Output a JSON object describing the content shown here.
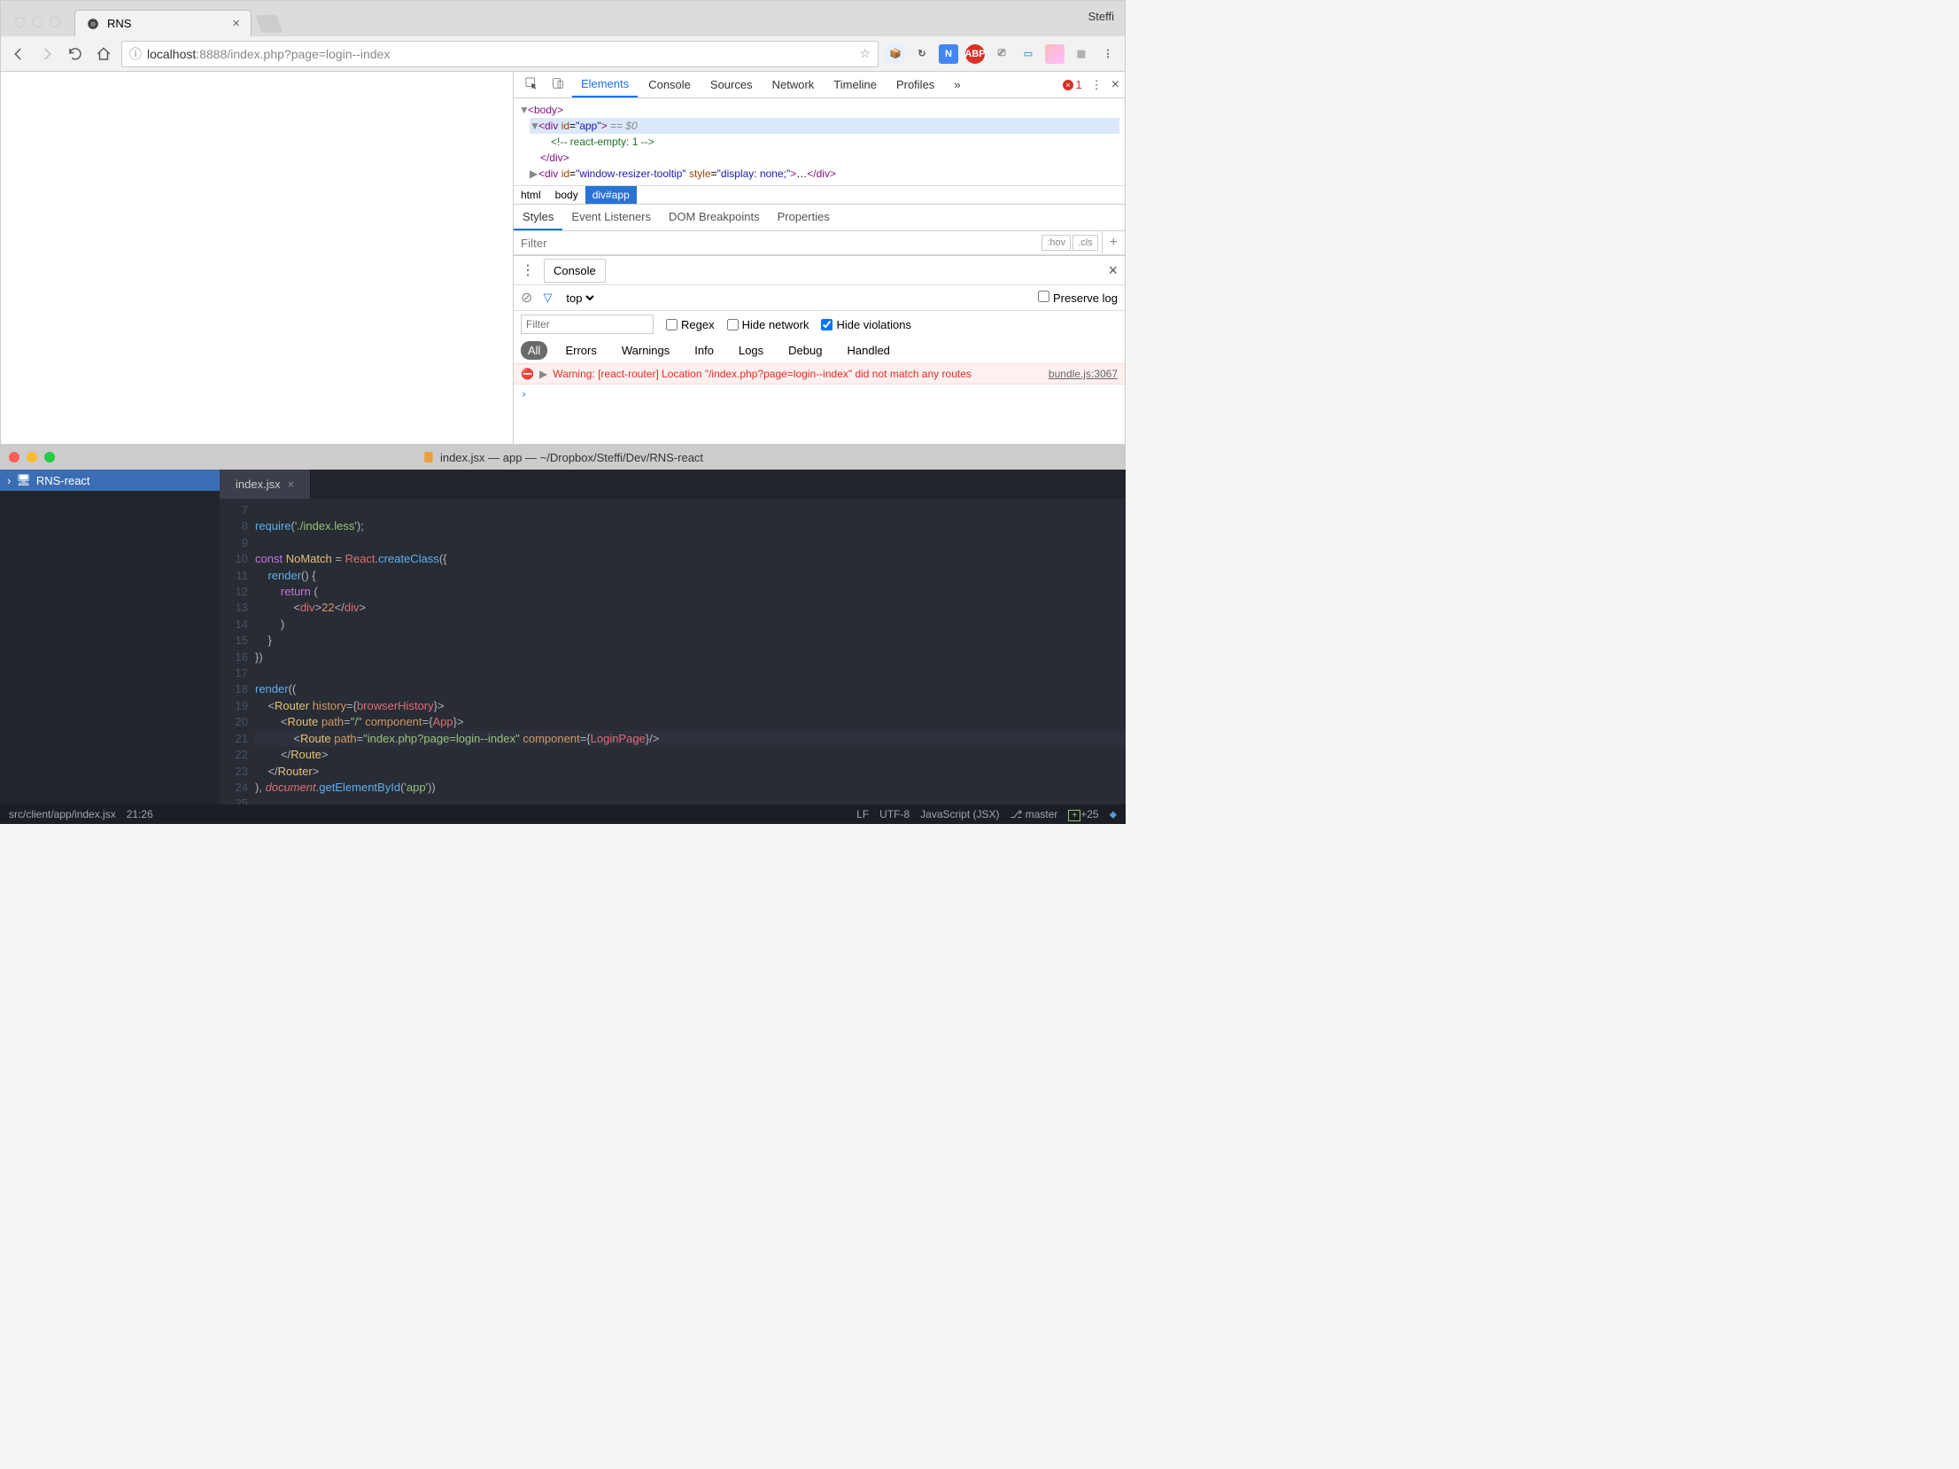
{
  "chrome": {
    "profile": "Steffi",
    "tab_title": "RNS",
    "url_host": "localhost",
    "url_port": ":8888",
    "url_path": "/index.php?page=login--index",
    "devtools": {
      "tabs": [
        "Elements",
        "Console",
        "Sources",
        "Network",
        "Timeline",
        "Profiles"
      ],
      "error_count": "1",
      "dom": {
        "body_open": "<body>",
        "div_app_open": "<div id=\"app\">",
        "eq0": " == $0",
        "react_comment": "<!-- react-empty: 1 -->",
        "div_close": "</div>",
        "window_resizer": "<div id=\"window-resizer-tooltip\" style=\"display: none;\">…</div>"
      },
      "breadcrumb": [
        "html",
        "body",
        "div#app"
      ],
      "styles_tabs": [
        "Styles",
        "Event Listeners",
        "DOM Breakpoints",
        "Properties"
      ],
      "filter_placeholder": "Filter",
      "hov": ":hov",
      "cls": ".cls",
      "console_label": "Console",
      "context": "top",
      "preserve_log": "Preserve log",
      "regex": "Regex",
      "hide_network": "Hide network",
      "hide_violations": "Hide violations",
      "pills": [
        "All",
        "Errors",
        "Warnings",
        "Info",
        "Logs",
        "Debug",
        "Handled"
      ],
      "warning_text": "Warning: [react-router] Location \"/index.php?page=login--index\" did not match any routes",
      "warning_src": "bundle.js:3067"
    }
  },
  "editor": {
    "title": "index.jsx — app — ~/Dropbox/Steffi/Dev/RNS-react",
    "project": "RNS-react",
    "tab": "index.jsx",
    "line_start": 7,
    "line_end": 25,
    "status_path": "src/client/app/index.jsx",
    "cursor": "21:26",
    "encoding_lf": "LF",
    "encoding_utf": "UTF-8",
    "mode": "JavaScript (JSX)",
    "branch": "master",
    "git_changes": "+25"
  }
}
